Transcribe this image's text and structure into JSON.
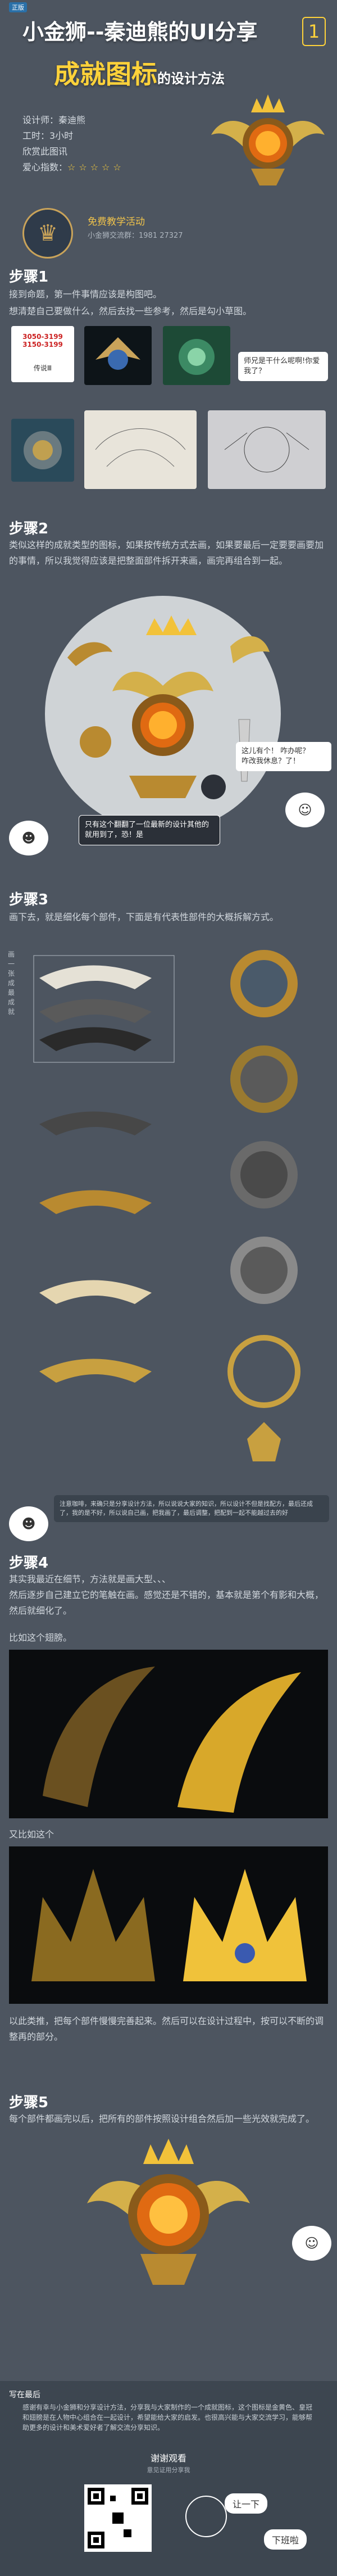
{
  "header": {
    "badge": "正版",
    "title1": "小金狮--秦迪熊的UI分享",
    "title2_big": "成就图标",
    "title2_small": "的设计方法",
    "number": "1"
  },
  "info": {
    "designer": "设计师：秦迪熊",
    "time": "工时：3小时",
    "type": "欣赏此图讯",
    "difficulty_label": "爱心指数：",
    "stars": "☆☆☆☆☆"
  },
  "promo": {
    "line1": "免费教学活动",
    "line2": "小金狮交流群：1981 27327"
  },
  "steps": {
    "s1_title": "步骤1",
    "s1_text1": "接到命题，第一件事情应该是构图吧。",
    "s1_text2": "想清楚自己要做什么，然后去找一些参考，然后是勾小草图。",
    "s1_bubble": "师兄是干什么呢啊!你爱我了？",
    "s1_badge_nums": "3050-3199\n3150-3199",
    "s1_badge_label": "传说Ⅲ",
    "s2_title": "步骤2",
    "s2_text": "类似这样的成就类型的图标，如果按传统方式去画，如果要最后一定要要画要加的事情，所以我觉得应该是把整面部件拆开来画，画完再组合到一起。",
    "s2_bubble1": "只有这个翻翻了一位最新的设计其他的就用到了，恐！是",
    "s2_bubble2": "这儿有个！ 咋办呢？\n咋改我休息？了！",
    "s3_title": "步骤3",
    "s3_text": "画下去，就是细化每个部件，下面是有代表性部件的大概拆解方式。",
    "s3_side": "画 一 张 成 最 成 就",
    "s3_bubble": "注意咖啡，来确只是分享设计方法，所以说说大家的知识，所以设计不但是找配方，最后还成了，我的是不好，所以说自己画，把我画了，最后调整，把配到一起不能越过去的好",
    "s4_title": "步骤4",
    "s4_text1": "其实我最近在细节，方法就是画大型、、、",
    "s4_text2": "然后逐步自己建立它的笔触在画。感觉还是不错的，基本就是第个有影和大概，然后就细化了。",
    "s4_label1": "比如这个翅膀。",
    "s4_label2": "又比如这个",
    "s4_text3": "以此类推，把每个部件慢慢完善起来。然后可以在设计过程中，按可以不断的调整再的部分。",
    "s5_title": "步骤5",
    "s5_text": "每个部件都画完以后，把所有的部件按照设计组合然后加一些光效就完成了。"
  },
  "footer": {
    "label": "写在最后",
    "text": "感谢有幸与小金狮和分享设计方法，分享我与大家制作的一个成就图标，这个图标是金黄色、皇冠和翅膀是在人物中心组合在一起设计，希望能给大家的启发。也很高兴能与大家交流学习，能够帮助更多的设计和美术爱好者了解交流分享知识。",
    "thanks": "谢谢观看",
    "thanks2": "意见证用分享我",
    "pill1": "让一下",
    "pill2": "下班啦"
  },
  "colors": {
    "bg": "#4d5560",
    "gold": "#ffd23a",
    "accent_blue": "#2a70a8"
  }
}
